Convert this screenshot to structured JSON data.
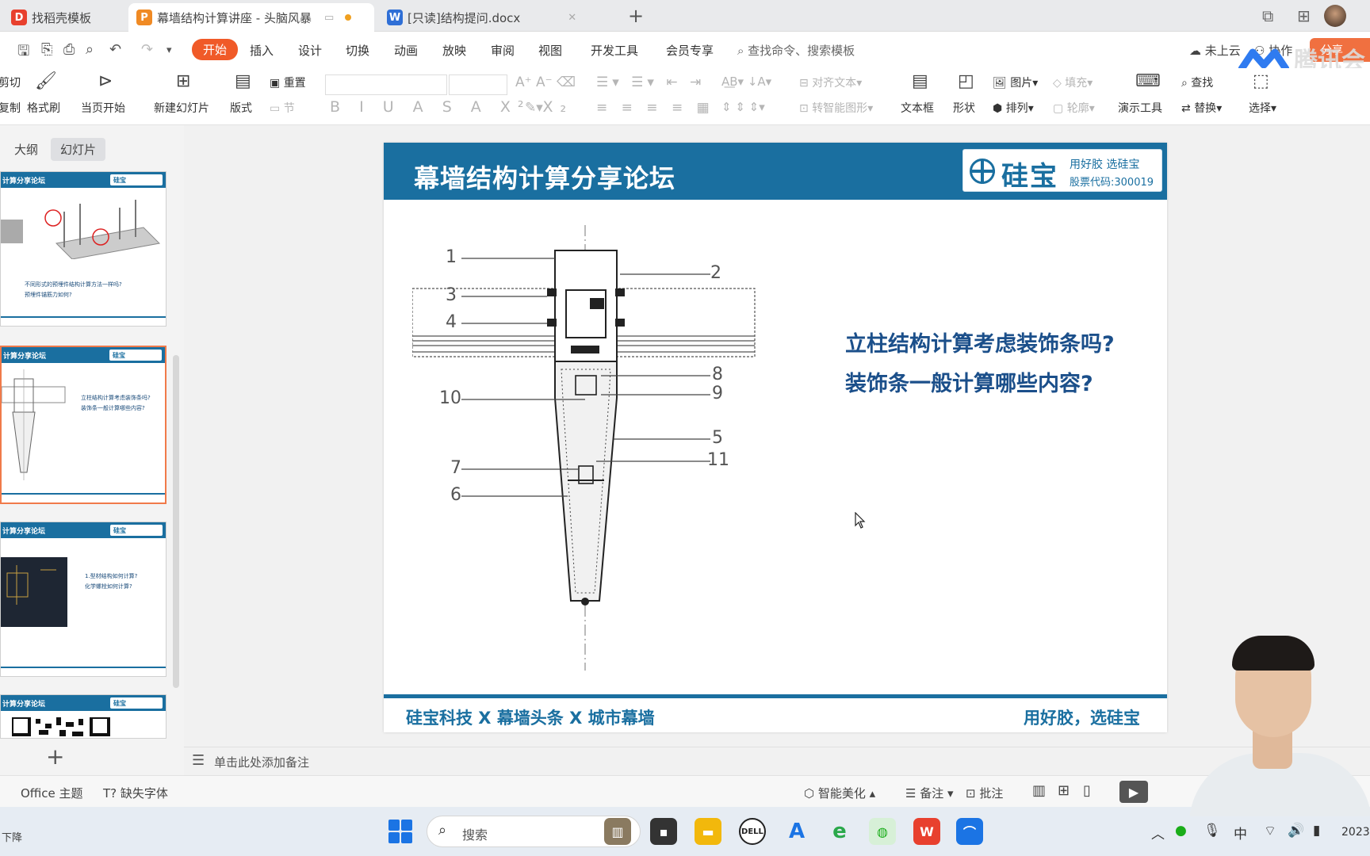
{
  "tabs": [
    {
      "label": "找稻壳模板",
      "icon": "D",
      "color": "#e8402e"
    },
    {
      "label": "幕墙结构计算讲座 - 头脑风暴",
      "icon": "P",
      "color": "#f08a24"
    },
    {
      "label": "[只读]结构提问.docx",
      "icon": "W",
      "color": "#2f6fd6"
    }
  ],
  "menu": {
    "items": [
      "开始",
      "插入",
      "设计",
      "切换",
      "动画",
      "放映",
      "审阅",
      "视图",
      "开发工具",
      "会员专享"
    ],
    "search": "查找命令、搜索模板",
    "cloud": "未上云",
    "collab": "协作",
    "share": "分享"
  },
  "watermark": "腾讯会",
  "ribbon": {
    "cut": "剪切",
    "copy": "复制",
    "format_painter": "格式刷",
    "from_current": "当页开始",
    "new_slide": "新建幻灯片",
    "layout": "版式",
    "reset": "重置",
    "section": "节",
    "align_text": "对齐文本",
    "smart_art": "转智能图形",
    "textbox": "文本框",
    "shape": "形状",
    "picture": "图片",
    "arrange": "排列",
    "fill": "填充",
    "outline": "轮廓",
    "present_tools": "演示工具",
    "find": "查找",
    "replace": "替换",
    "select": "选择"
  },
  "left_panel": {
    "tab_outline": "大纲",
    "tab_slides": "幻灯片",
    "thumb_title": "计算分享论坛",
    "thumb_logo": "硅宝",
    "thumb1_text": [
      "不同形式的预埋件结构计算方法一样吗?",
      "预埋件锚筋力如何?"
    ],
    "thumb2_text": [
      "立柱结构计算考虑装饰条吗?",
      "装饰条一般计算哪些内容?"
    ],
    "thumb3_text": [
      "1.型材结构如何计算?",
      "化学螺栓如何计算?"
    ]
  },
  "slide": {
    "title": "幕墙结构计算分享论坛",
    "logo_name": "硅宝",
    "logo_slogan": "用好胶 选硅宝",
    "logo_code": "股票代码:300019",
    "question1": "立柱结构计算考虑装饰条吗?",
    "question2": "装饰条一般计算哪些内容?",
    "footer_left": "硅宝科技 X 幕墙头条 X 城市幕墙",
    "footer_right": "用好胶，选硅宝",
    "callouts": [
      "1",
      "2",
      "3",
      "4",
      "8",
      "9",
      "10",
      "5",
      "11",
      "7",
      "6"
    ]
  },
  "notes": {
    "placeholder": "单击此处添加备注"
  },
  "status": {
    "theme": "Office 主题",
    "missing_font": "缺失字体",
    "beautify": "智能美化",
    "notes": "备注",
    "comment": "批注"
  },
  "taskbar": {
    "search": "搜索",
    "left_text": "下降",
    "ime": "中",
    "clock": "2023"
  }
}
